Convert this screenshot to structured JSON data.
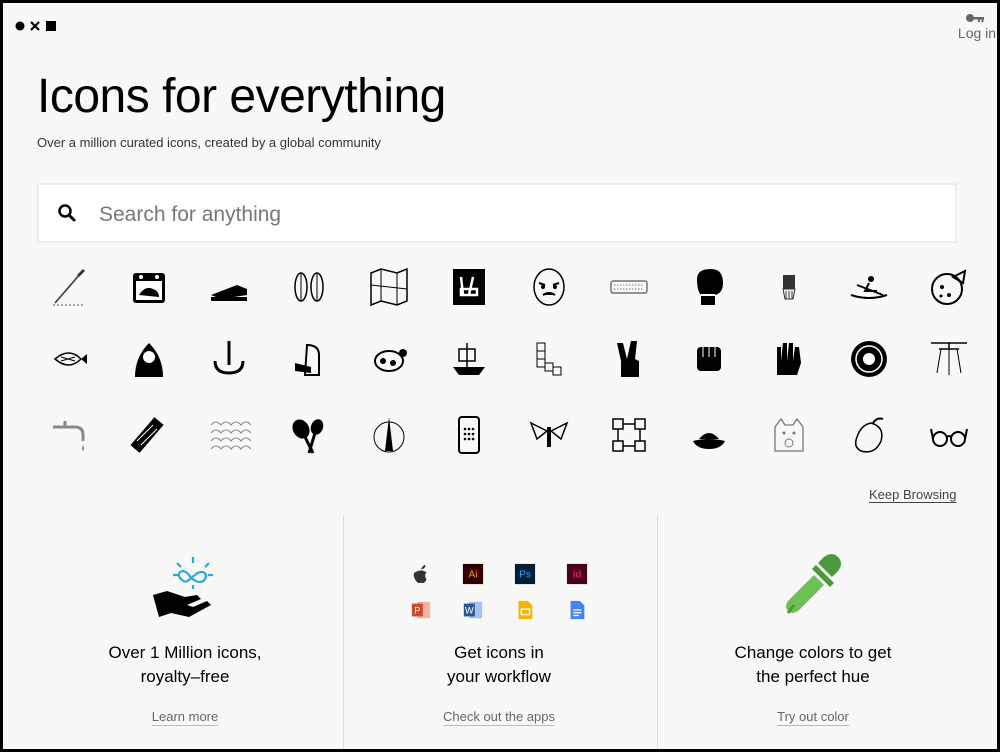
{
  "header": {
    "logo_icon": "dot-x-square-logo",
    "login_label": "Log in",
    "login_icon": "key-icon"
  },
  "hero": {
    "title": "Icons for everything",
    "subtitle": "Over a million curated icons, created by a global community"
  },
  "search": {
    "placeholder": "Search for anything",
    "icon": "search-icon"
  },
  "icon_grid": {
    "rows": [
      [
        "scalpel-icon",
        "calendar-dog-icon",
        "stapler-icon",
        "leaves-icon",
        "folded-map-icon",
        "peace-hand-card-icon",
        "opera-mask-icon",
        "keyboard-icon",
        "boxing-glove-icon",
        "brush-icon",
        "rowing-icon",
        "pizza-icon"
      ],
      [
        "fish-icon",
        "hooded-person-icon",
        "hook-icon",
        "dog-reading-icon",
        "turtle-icon",
        "pirate-ship-icon",
        "boxes-icon",
        "peace-sign-hand-icon",
        "fist-icon",
        "raised-hand-icon",
        "donut-icon",
        "lamp-icon"
      ],
      [
        "faucet-icon",
        "thread-spool-icon",
        "fish-scales-icon",
        "maracas-icon",
        "cathedral-icon",
        "smartphone-icon",
        "flying-creature-icon",
        "network-icon",
        "hat-icon",
        "lucky-cat-icon",
        "mango-icon",
        "glasses-icon"
      ]
    ],
    "keep_browsing": "Keep Browsing"
  },
  "features": [
    {
      "title_line1": "Over 1 Million icons,",
      "title_line2": "royalty–free",
      "link": "Learn more",
      "icon": "hand-infinity-icon"
    },
    {
      "title_line1": "Get icons in",
      "title_line2": "your workflow",
      "link": "Check out the apps",
      "icons": [
        "apple-icon",
        "illustrator-icon",
        "photoshop-icon",
        "indesign-icon",
        "powerpoint-icon",
        "word-icon",
        "google-slides-icon",
        "google-docs-icon"
      ]
    },
    {
      "title_line1": "Change colors to get",
      "title_line2": "the perfect hue",
      "link": "Try out color",
      "icon": "eyedropper-icon"
    }
  ],
  "colors": {
    "background": "#f8f8f8",
    "infinity": "#2aa8e0",
    "eyedropper": "#4a9a3a",
    "illustrator": "#ff9a00",
    "photoshop": "#31a8ff",
    "indesign": "#ff3366",
    "powerpoint": "#d24726",
    "word": "#2b579a",
    "slides": "#f4b400",
    "docs": "#4285f4"
  }
}
